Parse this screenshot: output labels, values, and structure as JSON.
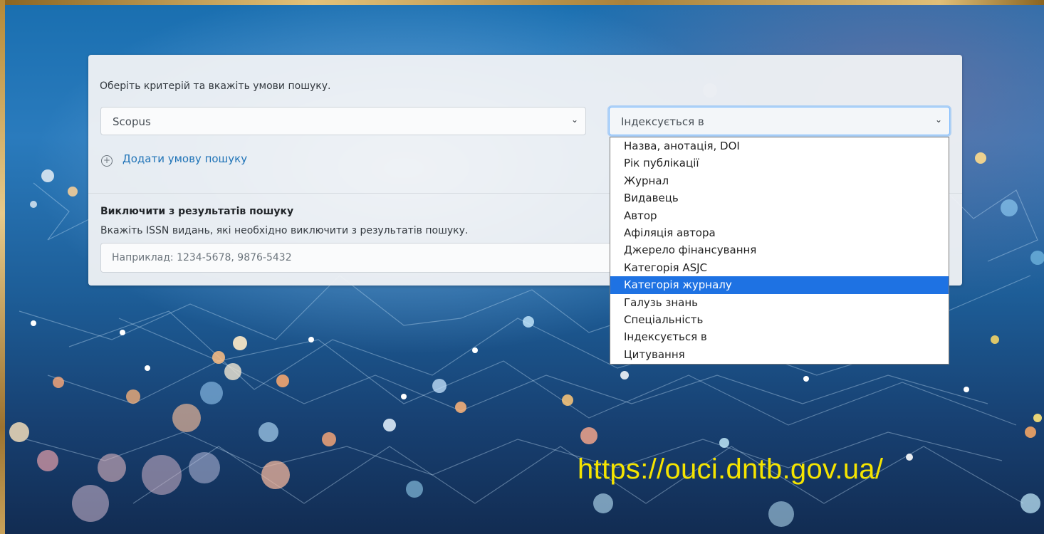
{
  "search": {
    "instruction": "Оберіть критерій та вкажіть умови пошуку.",
    "criterion_select": {
      "value": "Scopus",
      "icon": "chevron-down-icon"
    },
    "field_select": {
      "value": "Індексується в",
      "icon": "chevron-down-icon",
      "open": true
    },
    "add_condition_label": "Додати умову пошуку",
    "add_condition_icon": "plus-circle-icon"
  },
  "exclude": {
    "title": "Виключити з результатів пошуку",
    "description": "Вкажіть ISSN видань, які необхідно виключити з результатів пошуку.",
    "placeholder": "Наприклад: 1234-5678, 9876-5432"
  },
  "dropdown": {
    "options": [
      "Назва, анотація, DOI",
      "Рік публікації",
      "Журнал",
      "Видавець",
      "Автор",
      "Афіляція автора",
      "Джерело фінансування",
      "Категорія ASJC",
      "Категорія журналу",
      "Галузь знань",
      "Спеціальність",
      "Індексується в",
      "Цитування"
    ],
    "highlighted": "Категорія журналу"
  },
  "overlay": {
    "url": "https://ouci.dntb.gov.ua/"
  },
  "colors": {
    "highlight": "#1e72e3",
    "link": "#1f73b7",
    "url_text": "#f5e400",
    "frame": "#c79a45"
  }
}
